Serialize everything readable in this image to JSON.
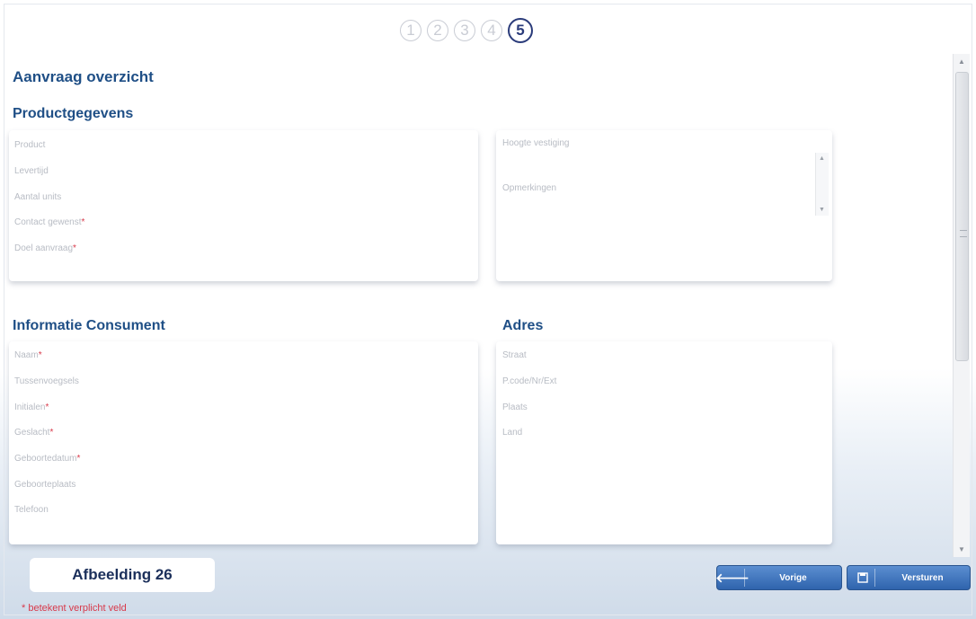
{
  "steps": [
    "1",
    "2",
    "3",
    "4",
    "5"
  ],
  "active_step": 5,
  "page_title": "Aanvraag overzicht",
  "product_section": {
    "title": "Productgegevens",
    "left_fields": [
      {
        "label": "Product",
        "required": false
      },
      {
        "label": "Levertijd",
        "required": false
      },
      {
        "label": "Aantal units",
        "required": false
      },
      {
        "label": "Contact gewenst",
        "required": true
      },
      {
        "label": "Doel aanvraag",
        "required": true
      }
    ],
    "right_fields": [
      {
        "label": "Hoogte vestiging",
        "required": false
      },
      {
        "label": "Opmerkingen",
        "required": false
      }
    ]
  },
  "consumer_section": {
    "title": "Informatie Consument",
    "fields": [
      {
        "label": "Naam",
        "required": true
      },
      {
        "label": "Tussenvoegsels",
        "required": false
      },
      {
        "label": "Initialen",
        "required": true
      },
      {
        "label": "Geslacht",
        "required": true
      },
      {
        "label": "Geboortedatum",
        "required": true
      },
      {
        "label": "Geboorteplaats",
        "required": false
      },
      {
        "label": "Telefoon",
        "required": false
      }
    ]
  },
  "address_section": {
    "title": "Adres",
    "fields": [
      {
        "label": "Straat",
        "required": false
      },
      {
        "label": "P.code/Nr/Ext",
        "required": false
      },
      {
        "label": "Plaats",
        "required": false
      },
      {
        "label": "Land",
        "required": false
      }
    ]
  },
  "caption": "Afbeelding 26",
  "footnote": "* betekent verplicht veld",
  "buttons": {
    "previous": {
      "label": "Vorige",
      "icon": "arrow-left-icon"
    },
    "submit": {
      "label": "Versturen",
      "icon": "save-icon"
    }
  },
  "colors": {
    "title": "#1f4f86",
    "required": "#d8394a",
    "button": "#3a70b8"
  }
}
